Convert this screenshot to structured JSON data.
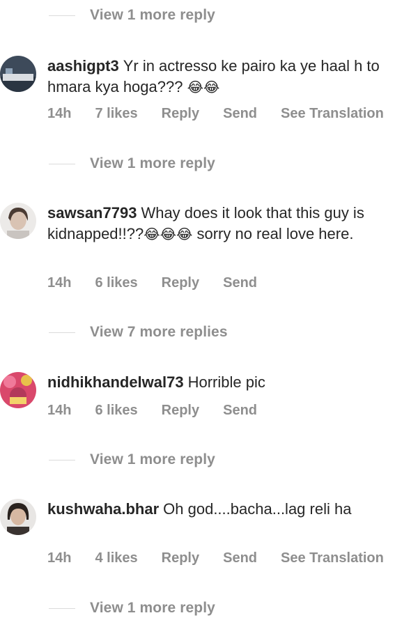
{
  "top_reply": {
    "label": "View 1 more reply"
  },
  "comments": [
    {
      "username": "aashigpt3",
      "text": "Yr in actresso ke pairo ka ye haal h to hmara kya hoga???",
      "emoji_after": "😂😂",
      "time": "14h",
      "likes": "7 likes",
      "reply": "Reply",
      "send": "Send",
      "translate": "See Translation",
      "view_replies": "View 1 more reply"
    },
    {
      "username": "sawsan7793",
      "text": "Whay does it look that this guy is kidnapped!!??",
      "emoji_after": "😂😂😂",
      "text_after": " sorry no real love here.",
      "time": "14h",
      "likes": "6 likes",
      "reply": "Reply",
      "send": "Send",
      "view_replies": "View 7 more replies"
    },
    {
      "username": "nidhikhandelwal73",
      "text": "Horrible pic",
      "time": "14h",
      "likes": "6 likes",
      "reply": "Reply",
      "send": "Send",
      "view_replies": "View 1 more reply"
    },
    {
      "username": "kushwaha.bhar",
      "text": "Oh god....bacha...lag reli ha",
      "time": "14h",
      "likes": "4 likes",
      "reply": "Reply",
      "send": "Send",
      "translate": "See Translation",
      "view_replies": "View 1 more reply"
    }
  ],
  "colors": {
    "primary_text": "#262626",
    "secondary_text": "#8e8e8e",
    "divider": "#dbdbdb"
  }
}
